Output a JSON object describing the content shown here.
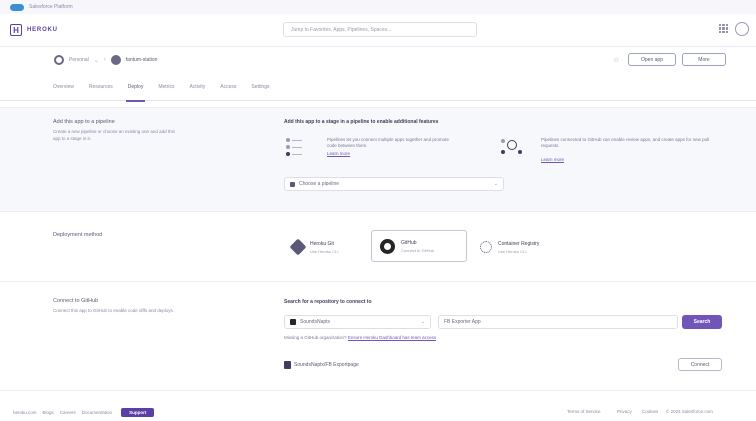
{
  "topstrip": {
    "label": "Salesforce Platform"
  },
  "topnav": {
    "logo": "H",
    "brand": "HEROKU",
    "search_placeholder": "Jump to Favorites, Apps, Pipelines, Spaces..."
  },
  "app_header": {
    "org": "Personal",
    "app_name": "fantum-station",
    "open_app": "Open app",
    "more": "More"
  },
  "tabs": [
    "Overview",
    "Resources",
    "Deploy",
    "Metrics",
    "Activity",
    "Access",
    "Settings"
  ],
  "pipeline_section": {
    "title": "Add this app to a pipeline",
    "desc": "Create a new pipeline or choose an existing one and add this app to a stage in it.",
    "heading": "Add this app to a stage in a pipeline to enable additional features",
    "feature1_text": "Pipelines let you connect multiple apps together and promote code between them.",
    "feature1_link": "Learn more",
    "feature2_text": "Pipelines connected to GitHub can enable review apps, and create apps for new pull requests.",
    "feature2_link": "Learn more",
    "select": "Choose a pipeline"
  },
  "deploy_section": {
    "title": "Deployment method",
    "options": [
      {
        "title": "Heroku Git",
        "sub": "Use Heroku CLI"
      },
      {
        "title": "GitHub",
        "sub": "Connect to GitHub"
      },
      {
        "title": "Container Registry",
        "sub": "Use Heroku CLI"
      }
    ]
  },
  "github_section": {
    "title": "Connect to GitHub",
    "desc": "Connect this app to GitHub to enable code diffs and deploys.",
    "heading": "Search for a repository to connect to",
    "owner": "SoundsNaptx",
    "repo_input": "FB Exporter App",
    "search_btn": "Search",
    "missing_text": "Missing a GitHub organization?",
    "missing_link": "Ensure Heroku Dashboard has team access",
    "repo_row": "SoundsNaptx/FB Exportpage",
    "connect_btn": "Connect"
  },
  "footer": {
    "links": [
      "heroku.com",
      "Blogs",
      "Careers",
      "Documentation"
    ],
    "support": "Support",
    "right_links": [
      "Terms of Service",
      "Privacy",
      "Cookies",
      "© 2024 Salesforce.com"
    ]
  }
}
